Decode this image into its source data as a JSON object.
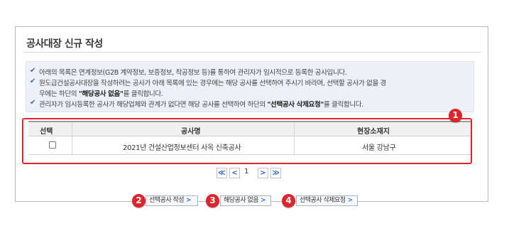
{
  "page_title": "공사대장 신규 작성",
  "notice": {
    "items": [
      "아래의 목록은 연계정보(G2B 계약정보, 보증정보, 착공정보 등)를 통하여 관리자가 임시적으로 등록한 공사입니다.",
      "원도급건설공사대장을 작성하려는 공사가 아래 목록에 있는 경우에는 해당 공사를 선택하여 주시기 바라며, 선택할 공사가 없을 경",
      "관리자가 임시등록한 공사가 해당업체와 관계가 없다면 해당 공사를 선택하여 하단의"
    ],
    "item2_cont_pre": "우에는 하단의",
    "item2_cont_bold": "\"해당공사 없음\"",
    "item2_cont_post": "를 클릭합니다.",
    "item3_bold": "\"선택공사 삭제요청\"",
    "item3_post": "를 클릭합니다."
  },
  "table": {
    "headers": [
      "선택",
      "공사명",
      "현장소재지"
    ],
    "rows": [
      {
        "name": "2021년 건설산업정보센터 사옥 신축공사",
        "location": "서울 강남구"
      }
    ]
  },
  "pagination": {
    "first": "≪",
    "prev": "<",
    "current": "1",
    "next": ">",
    "last": "≫"
  },
  "buttons": {
    "select_write": "선택공사 작성",
    "no_project": "해당공사 없음",
    "delete_request": "선택공사 삭제요청",
    "arrow": ">"
  },
  "badges": [
    "1",
    "2",
    "3",
    "4"
  ],
  "colors": {
    "highlight": "#e0242c",
    "check": "#2f6fc4",
    "notice_bg": "#eef0f7"
  }
}
